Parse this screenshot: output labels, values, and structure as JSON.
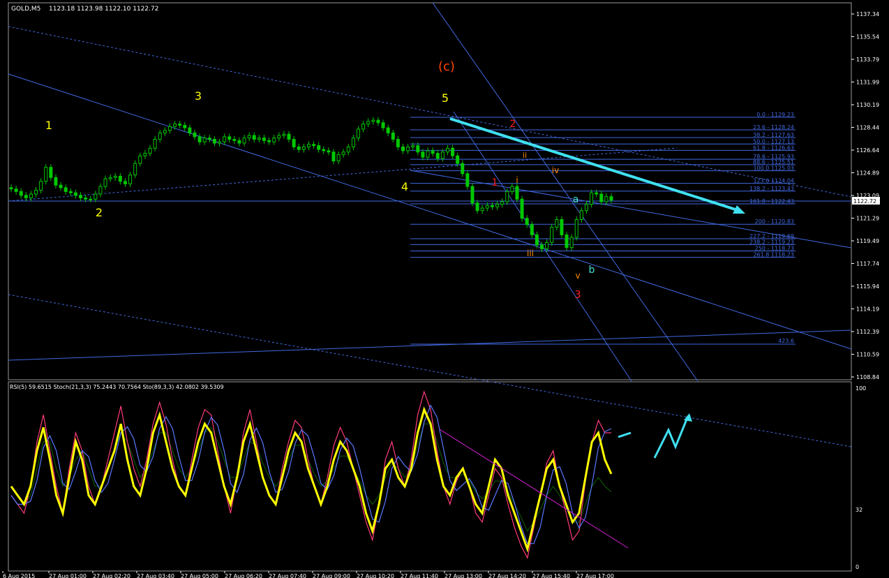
{
  "header": {
    "symbol": "GOLD,M5",
    "ohlc": "1123.18 1123.98 1122.10 1122.72"
  },
  "indicator_header": "RSI(5) 59.6515  Stoch(21,3,3) 75.2443 70.7564  Sto(89,3,3) 42.0802 39.5309",
  "colors": {
    "background": "#000000",
    "candles": "#00c800",
    "trendline": "#4169e1",
    "fib": "#4169e1",
    "arrow": "#40e0f0",
    "rsi": "#ffff00",
    "stoch_fast": "#ff3c78",
    "stoch_signal": "#5a78ff",
    "stoch_slow": "#0a6400",
    "magenta_trend": "#d21ed2",
    "wave_yellow": "#ffff00",
    "wave_orange": "#ff4500",
    "wave_red": "#ff2020",
    "wave_subwave": "#ff8c00",
    "wave_cyan": "#40e0d0"
  },
  "price_axis": {
    "labels": [
      "1137.34",
      "1135.54",
      "1133.79",
      "1131.99",
      "1130.19",
      "1128.44",
      "1126.64",
      "1124.89",
      "1123.09",
      "1121.29",
      "1119.49",
      "1117.74",
      "1115.94",
      "1114.19",
      "1112.39",
      "1110.59",
      "1108.84"
    ],
    "current": "1122.72"
  },
  "time_axis": [
    "6 Aug 2015",
    "27 Aug 01:00",
    "27 Aug 02:20",
    "27 Aug 03:40",
    "27 Aug 05:00",
    "27 Aug 06:20",
    "27 Aug 07:40",
    "27 Aug 09:00",
    "27 Aug 10:20",
    "27 Aug 11:40",
    "27 Aug 13:00",
    "27 Aug 14:20",
    "27 Aug 15:40",
    "27 Aug 17:00"
  ],
  "indicator_axis": [
    "100",
    "32",
    "0"
  ],
  "fib_levels": [
    {
      "label": "0.0 - 1129.23",
      "price": 1129.23
    },
    {
      "label": "23.6 - 1128.24",
      "price": 1128.24
    },
    {
      "label": "38.2 - 1127.63",
      "price": 1127.63
    },
    {
      "label": "50.0 - 1127.13",
      "price": 1127.13
    },
    {
      "label": "61.8 - 1126.63",
      "price": 1126.63
    },
    {
      "label": "78.6 - 1125.93",
      "price": 1125.93
    },
    {
      "label": "88.6 - 1125.51",
      "price": 1125.51
    },
    {
      "label": "100.0 1125.03",
      "price": 1125.03
    },
    {
      "label": "123.6 1124.04",
      "price": 1124.04
    },
    {
      "label": "138.2 - 1123.43",
      "price": 1123.43
    },
    {
      "label": "161.8 - 1122.43",
      "price": 1122.43
    },
    {
      "label": "200 - 1120.83",
      "price": 1120.83
    },
    {
      "label": "227.2 - 1119.69",
      "price": 1119.69
    },
    {
      "label": "238.2 - 1119.23",
      "price": 1119.23
    },
    {
      "label": "250 - 1118.73",
      "price": 1118.73
    },
    {
      "label": "261.8 1118.23",
      "price": 1118.23
    }
  ],
  "extra_level": {
    "label": "423.6"
  },
  "wave_labels": [
    {
      "text": "1",
      "color": "yellow"
    },
    {
      "text": "2",
      "color": "yellow"
    },
    {
      "text": "3",
      "color": "yellow"
    },
    {
      "text": "4",
      "color": "yellow"
    },
    {
      "text": "5",
      "color": "yellow"
    },
    {
      "text": "(c)",
      "color": "orange"
    },
    {
      "text": "1",
      "color": "red"
    },
    {
      "text": "2",
      "color": "red"
    },
    {
      "text": "3",
      "color": "red"
    },
    {
      "text": "i",
      "color": "subwave"
    },
    {
      "text": "ii",
      "color": "subwave"
    },
    {
      "text": "iii",
      "color": "subwave"
    },
    {
      "text": "iv",
      "color": "subwave"
    },
    {
      "text": "v",
      "color": "subwave"
    },
    {
      "text": "a",
      "color": "cyan"
    },
    {
      "text": "b",
      "color": "cyan"
    }
  ],
  "chart_data": {
    "type": "line",
    "title": "GOLD,M5",
    "ylim": [
      1108.84,
      1137.34
    ],
    "x_ticks": [
      "6 Aug 2015",
      "27 Aug 01:00",
      "27 Aug 02:20",
      "27 Aug 03:40",
      "27 Aug 05:00",
      "27 Aug 06:20",
      "27 Aug 07:40",
      "27 Aug 09:00",
      "27 Aug 10:20",
      "27 Aug 11:40",
      "27 Aug 13:00",
      "27 Aug 14:20",
      "27 Aug 15:40",
      "27 Aug 17:00"
    ],
    "series": [
      {
        "type": "candles",
        "close": [
          1123.6,
          1123.4,
          1123.1,
          1122.9,
          1123.2,
          1123.5,
          1124.2,
          1125.3,
          1124.5,
          1123.9,
          1123.7,
          1123.4,
          1123.3,
          1123.1,
          1122.9,
          1122.8,
          1122.8,
          1123.2,
          1123.8,
          1124.4,
          1124.5,
          1124.6,
          1124.2,
          1124.0,
          1124.7,
          1125.6,
          1126.2,
          1126.4,
          1126.8,
          1127.5,
          1128.0,
          1128.2,
          1128.5,
          1128.7,
          1128.6,
          1128.4,
          1128.0,
          1127.7,
          1127.3,
          1127.6,
          1127.5,
          1127.2,
          1127.3,
          1127.7,
          1127.5,
          1127.4,
          1127.2,
          1127.6,
          1127.8,
          1127.5,
          1127.6,
          1127.4,
          1127.3,
          1127.6,
          1127.8,
          1127.9,
          1127.5,
          1126.9,
          1126.7,
          1126.9,
          1127.1,
          1127.0,
          1126.7,
          1126.6,
          1126.5,
          1125.8,
          1126.3,
          1126.5,
          1126.9,
          1127.6,
          1128.3,
          1128.7,
          1128.9,
          1129.0,
          1128.8,
          1128.4,
          1128.0,
          1127.5,
          1126.9,
          1126.6,
          1126.9,
          1127.0,
          1126.5,
          1126.1,
          1126.6,
          1126.4,
          1126.0,
          1126.5,
          1126.8,
          1126.2,
          1125.6,
          1124.8,
          1123.8,
          1122.5,
          1121.9,
          1122.1,
          1122.3,
          1122.2,
          1122.4,
          1122.6,
          1123.4,
          1123.8,
          1122.8,
          1121.3,
          1120.8,
          1120.0,
          1119.2,
          1118.9,
          1119.4,
          1120.6,
          1121.2,
          1120.0,
          1119.0,
          1119.8,
          1121.2,
          1121.9,
          1122.4,
          1123.3,
          1123.2,
          1122.6,
          1123.0,
          1122.72
        ],
        "x_range": [
          0,
          121
        ]
      },
      {
        "name": "RSI(5)",
        "values": [
          45,
          40,
          35,
          45,
          65,
          78,
          60,
          40,
          30,
          50,
          70,
          60,
          40,
          35,
          45,
          55,
          65,
          80,
          60,
          45,
          40,
          55,
          75,
          85,
          70,
          55,
          45,
          40,
          55,
          70,
          80,
          75,
          60,
          45,
          35,
          50,
          70,
          80,
          65,
          50,
          40,
          35,
          50,
          65,
          75,
          70,
          55,
          45,
          35,
          45,
          60,
          70,
          65,
          55,
          45,
          30,
          20,
          35,
          55,
          60,
          50,
          45,
          55,
          75,
          88,
          80,
          60,
          45,
          40,
          50,
          55,
          45,
          35,
          30,
          45,
          60,
          55,
          40,
          30,
          20,
          10,
          25,
          40,
          55,
          60,
          45,
          35,
          25,
          30,
          50,
          70,
          75,
          60,
          52
        ]
      },
      {
        "name": "Stoch(21,3,3)",
        "values": [
          40,
          35,
          30,
          45,
          70,
          85,
          65,
          45,
          30,
          55,
          75,
          65,
          45,
          35,
          45,
          60,
          75,
          90,
          70,
          55,
          45,
          60,
          80,
          92,
          80,
          60,
          45,
          40,
          60,
          78,
          88,
          85,
          65,
          45,
          30,
          50,
          75,
          88,
          70,
          50,
          40,
          35,
          55,
          70,
          82,
          78,
          60,
          45,
          35,
          50,
          68,
          78,
          70,
          55,
          40,
          25,
          15,
          35,
          60,
          70,
          55,
          45,
          60,
          85,
          98,
          88,
          65,
          45,
          35,
          48,
          55,
          45,
          30,
          25,
          40,
          55,
          50,
          35,
          22,
          12,
          5,
          22,
          40,
          58,
          65,
          45,
          30,
          15,
          20,
          48,
          70,
          82,
          75,
          75
        ]
      },
      {
        "name": "Sto(89,3,3)",
        "values": [
          45,
          40,
          35,
          40,
          55,
          70,
          70,
          55,
          45,
          50,
          60,
          65,
          55,
          45,
          45,
          55,
          65,
          75,
          70,
          60,
          50,
          55,
          65,
          75,
          75,
          65,
          55,
          50,
          55,
          65,
          75,
          78,
          70,
          60,
          50,
          50,
          60,
          70,
          68,
          58,
          50,
          45,
          50,
          60,
          68,
          68,
          60,
          52,
          45,
          48,
          55,
          62,
          62,
          55,
          48,
          40,
          35,
          40,
          50,
          58,
          55,
          50,
          55,
          68,
          80,
          80,
          70,
          58,
          50,
          50,
          52,
          48,
          42,
          38,
          42,
          48,
          48,
          42,
          35,
          28,
          20,
          25,
          32,
          40,
          45,
          40,
          33,
          25,
          25,
          35,
          45,
          50,
          45,
          42
        ]
      }
    ]
  }
}
